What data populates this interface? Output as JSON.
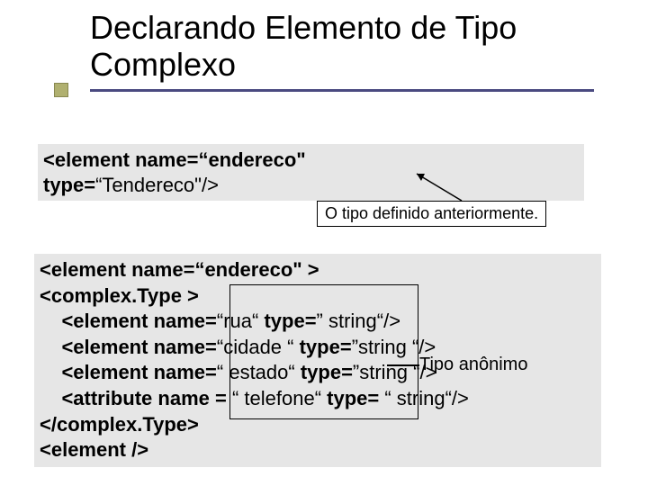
{
  "title": "Declarando Elemento de Tipo Complexo",
  "code1": {
    "line1_a": "<element ",
    "line1_b": "name=",
    "line1_c": "“endereco\"",
    "line2_a": "type=",
    "line2_b": "“Tendereco\"/>"
  },
  "note1": "O tipo definido anteriormente.",
  "code2": {
    "l1_a": "<element ",
    "l1_b": "name=",
    "l1_c": "“endereco\" >",
    "l2": "<complex.Type >",
    "l3_a": "    <element ",
    "l3_b": "name=",
    "l3_c": "“rua“ ",
    "l3_d": "type=",
    "l3_e": "” string“/>",
    "l4_a": "    <element ",
    "l4_b": "name=",
    "l4_c": "“cidade “ ",
    "l4_d": "type=",
    "l4_e": "”string “/>",
    "l5_a": "    <element ",
    "l5_b": "name=",
    "l5_c": "“ estado“ ",
    "l5_d": "type=",
    "l5_e": "”string “/>",
    "l6_a": "    <attribute ",
    "l6_b": "name =",
    "l6_c": " “ telefone“ ",
    "l6_d": "type=",
    "l6_e": " “ string“/>",
    "l7": "</complex.Type>",
    "l8": "<element />"
  },
  "note2": "Tipo anônimo"
}
